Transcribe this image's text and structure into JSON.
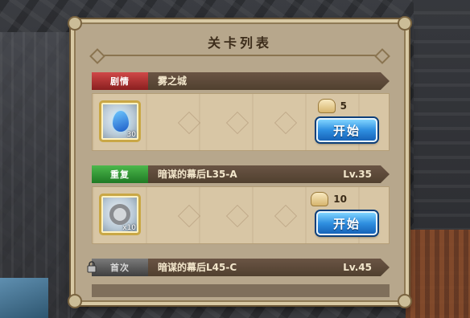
{
  "panel": {
    "title": "关卡列表"
  },
  "stages": [
    {
      "tag": "剧情",
      "tag_type": "story",
      "name": "雾之城",
      "level": "",
      "item_icon": "blue-crystal-icon",
      "item_count": "30",
      "cost": "5",
      "start_label": "开始"
    },
    {
      "tag": "重复",
      "tag_type": "repeat",
      "name": "暗谋的幕后L35-A",
      "level": "Lv.35",
      "item_icon": "ring-icon",
      "item_count": "x10",
      "cost": "10",
      "start_label": "开始"
    },
    {
      "tag": "首次",
      "tag_type": "first",
      "name": "暗谋的幕后L45-C",
      "level": "Lv.45",
      "locked": true
    }
  ],
  "colors": {
    "start_button": "#2f8fe0",
    "story_tag": "#c23b3b",
    "repeat_tag": "#3a9a3a",
    "panel_bg": "#b7a78c"
  }
}
